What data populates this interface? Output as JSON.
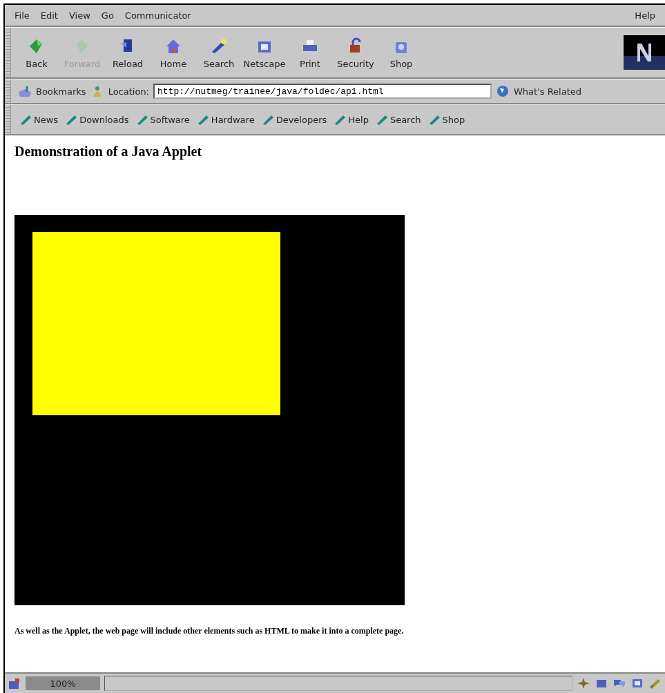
{
  "menu": [
    "File",
    "Edit",
    "View",
    "Go",
    "Communicator"
  ],
  "help_menu": "Help",
  "toolbar": [
    {
      "label": "Back",
      "disabled": false
    },
    {
      "label": "Forward",
      "disabled": true
    },
    {
      "label": "Reload",
      "disabled": false
    },
    {
      "label": "Home",
      "disabled": false
    },
    {
      "label": "Search",
      "disabled": false
    },
    {
      "label": "Netscape",
      "disabled": false
    },
    {
      "label": "Print",
      "disabled": false
    },
    {
      "label": "Security",
      "disabled": false
    },
    {
      "label": "Shop",
      "disabled": false
    }
  ],
  "location_bar": {
    "bookmarks": "Bookmarks",
    "location_label": "Location:",
    "url": "http://nutmeg/trainee/java/foldec/ap1.html",
    "whats_related": "What's Related"
  },
  "personal_toolbar": [
    "News",
    "Downloads",
    "Software",
    "Hardware",
    "Developers",
    "Help",
    "Search",
    "Shop"
  ],
  "page": {
    "heading": "Demonstration of a Java Applet",
    "paragraph": "As well as the Applet, the web page will include other elements such as HTML to make it into a complete page."
  },
  "status_bar": {
    "zoom": "100%"
  }
}
